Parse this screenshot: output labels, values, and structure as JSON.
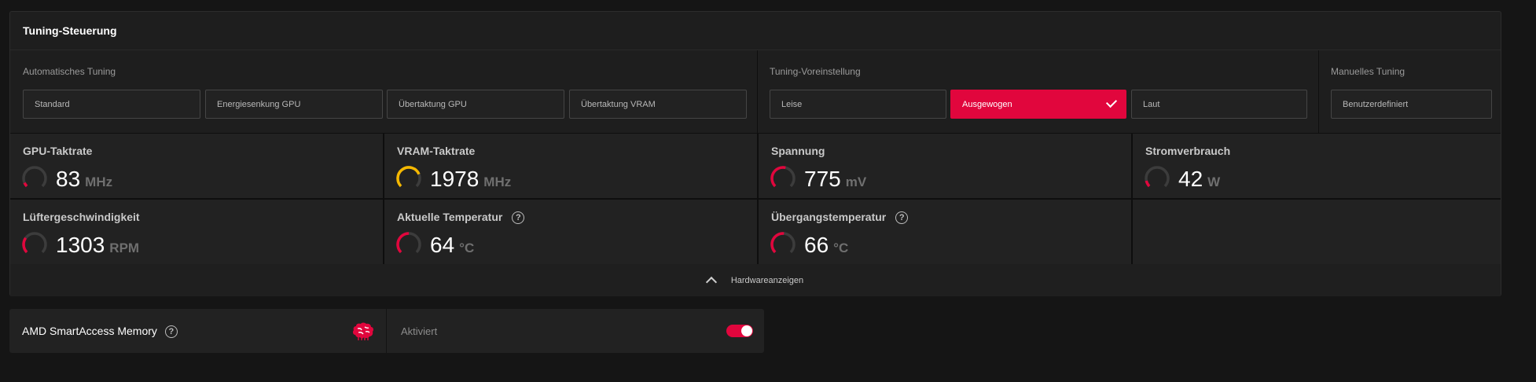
{
  "panel": {
    "title": "Tuning-Steuerung",
    "hardware_toggle_label": "Hardwareanzeigen"
  },
  "auto_tuning": {
    "label": "Automatisches Tuning",
    "options": [
      "Standard",
      "Energiesenkung GPU",
      "Übertaktung GPU",
      "Übertaktung VRAM"
    ]
  },
  "preset": {
    "label": "Tuning-Voreinstellung",
    "options": [
      "Leise",
      "Ausgewogen",
      "Laut"
    ],
    "selected": "Ausgewogen"
  },
  "manual_tuning": {
    "label": "Manuelles Tuning",
    "option": "Benutzerdefiniert"
  },
  "metrics": [
    {
      "label": "GPU-Taktrate",
      "value": "83",
      "unit": "MHz",
      "gauge_fraction": 0.08,
      "gauge_color": "#e1063d",
      "help": false
    },
    {
      "label": "VRAM-Taktrate",
      "value": "1978",
      "unit": "MHz",
      "gauge_fraction": 0.75,
      "gauge_color": "#f5b800",
      "help": false
    },
    {
      "label": "Spannung",
      "value": "775",
      "unit": "mV",
      "gauge_fraction": 0.55,
      "gauge_color": "#e1063d",
      "help": false
    },
    {
      "label": "Stromverbrauch",
      "value": "42",
      "unit": "W",
      "gauge_fraction": 0.12,
      "gauge_color": "#e1063d",
      "help": false
    },
    {
      "label": "Lüftergeschwindigkeit",
      "value": "1303",
      "unit": "RPM",
      "gauge_fraction": 0.3,
      "gauge_color": "#e1063d",
      "help": false
    },
    {
      "label": "Aktuelle Temperatur",
      "value": "64",
      "unit": "°C",
      "gauge_fraction": 0.5,
      "gauge_color": "#e1063d",
      "help": true
    },
    {
      "label": "Übergangstemperatur",
      "value": "66",
      "unit": "°C",
      "gauge_fraction": 0.52,
      "gauge_color": "#e1063d",
      "help": true
    }
  ],
  "smartaccess": {
    "title": "AMD SmartAccess Memory",
    "status": "Aktiviert",
    "enabled": true,
    "icon": "brain-icon"
  },
  "colors": {
    "accent": "#e1063d",
    "gauge_track": "#3c3c3c",
    "vram_gauge": "#f5b800"
  }
}
